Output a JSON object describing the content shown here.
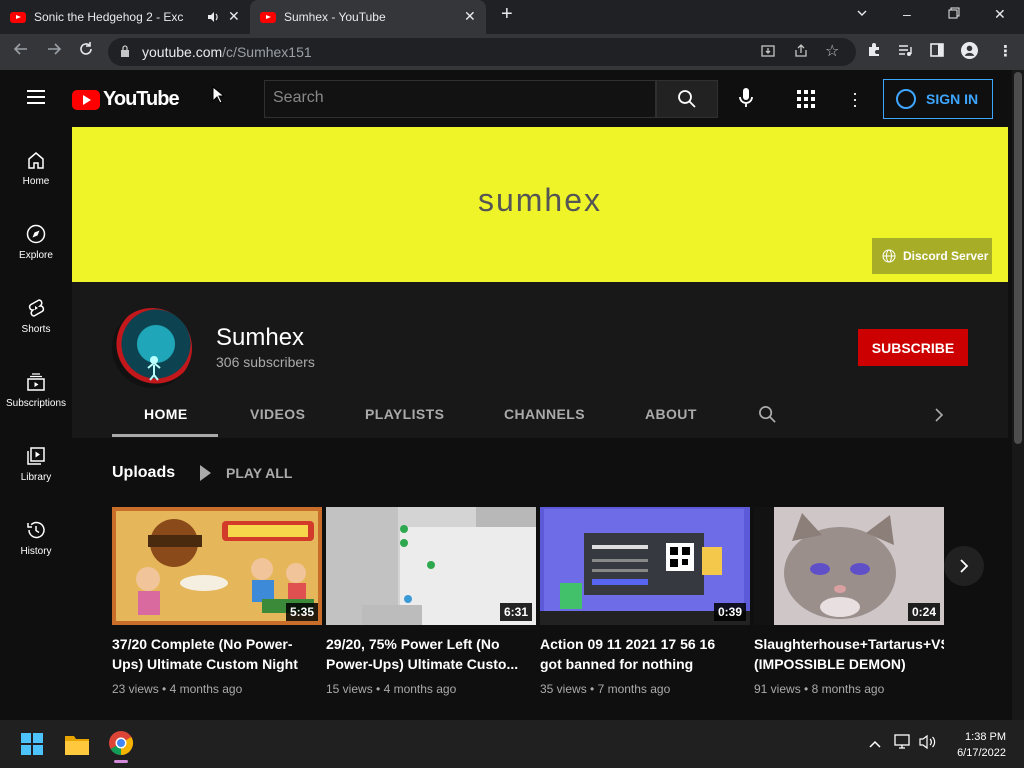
{
  "browser": {
    "tabs": [
      {
        "title": "Sonic the Hedgehog 2 - Exc"
      },
      {
        "title": "Sumhex - YouTube"
      }
    ],
    "url_host": "youtube.com",
    "url_path": "/c/Sumhex151"
  },
  "youtube": {
    "logo_text": "YouTube",
    "search_placeholder": "Search",
    "signin_label": "SIGN IN",
    "guide": [
      {
        "label": "Home"
      },
      {
        "label": "Explore"
      },
      {
        "label": "Shorts"
      },
      {
        "label": "Subscriptions"
      },
      {
        "label": "Library"
      },
      {
        "label": "History"
      }
    ]
  },
  "channel": {
    "banner_text": "sumhex",
    "discord_label": "Discord Server",
    "name": "Sumhex",
    "subscribers": "306 subscribers",
    "subscribe_label": "SUBSCRIBE",
    "tabs": [
      "HOME",
      "VIDEOS",
      "PLAYLISTS",
      "CHANNELS",
      "ABOUT"
    ]
  },
  "uploads": {
    "title": "Uploads",
    "play_all": "PLAY ALL",
    "videos": [
      {
        "duration": "5:35",
        "title_1": "37/20 Complete (No Power-",
        "title_2": "Ups) Ultimate Custom Night",
        "views": "23 views",
        "age": "4 months ago"
      },
      {
        "duration": "6:31",
        "title_1": "29/20, 75% Power Left (No",
        "title_2": "Power-Ups) Ultimate Custo...",
        "views": "15 views",
        "age": "4 months ago"
      },
      {
        "duration": "0:39",
        "title_1": "Action 09 11 2021 17 56 16",
        "title_2": "got banned for nothing",
        "views": "35 views",
        "age": "7 months ago"
      },
      {
        "duration": "0:24",
        "title_1": "Slaughterhouse+Tartarus+VS",
        "title_2": "(IMPOSSIBLE DEMON)",
        "views": "91 views",
        "age": "8 months ago"
      }
    ]
  },
  "taskbar": {
    "time": "1:38 PM",
    "date": "6/17/2022"
  },
  "colors": {
    "accent_red": "#cc0000",
    "banner_yellow": "#eef428",
    "signin_blue": "#3ea6ff"
  }
}
